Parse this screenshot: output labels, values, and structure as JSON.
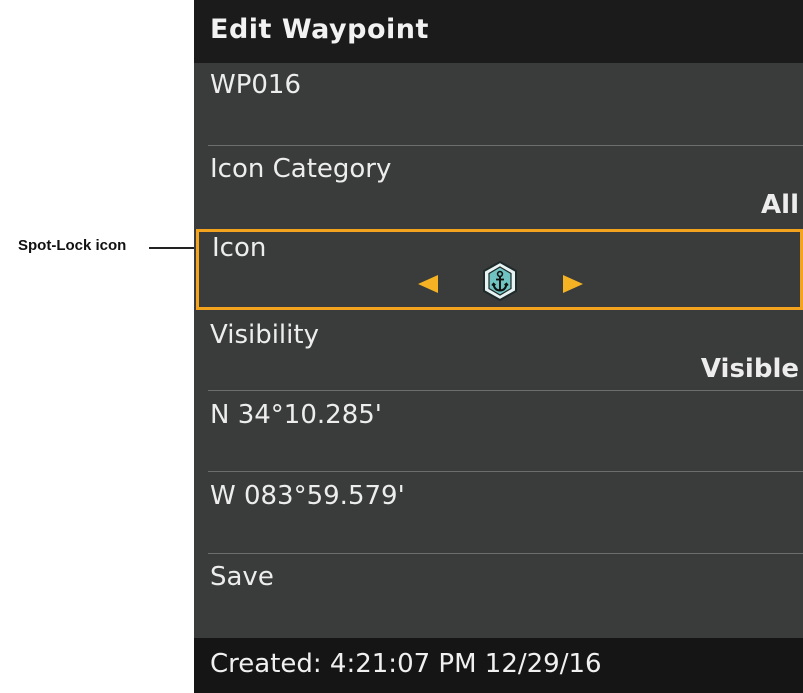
{
  "callout": {
    "label": "Spot-Lock icon"
  },
  "header": {
    "title": "Edit Waypoint"
  },
  "rows": {
    "name": {
      "label": "WP016"
    },
    "icon_category": {
      "label": "Icon Category",
      "value": "All"
    },
    "icon": {
      "label": "Icon",
      "current_icon": "anchor-spot-lock-icon",
      "prev": "arrow-left-icon",
      "next": "arrow-right-icon"
    },
    "visibility": {
      "label": "Visibility",
      "value": "Visible"
    },
    "latitude": {
      "label": "N 34°10.285'"
    },
    "longitude": {
      "label": "W 083°59.579'"
    },
    "save": {
      "label": "Save"
    }
  },
  "footer": {
    "text": "Created: 4:21:07 PM 12/29/16"
  },
  "colors": {
    "panel_bg": "#3a3c3c",
    "header_bg": "#1b1b1b",
    "selection_border": "#f3a31d",
    "arrow": "#f5b323",
    "icon_fill": "#6fc3c0"
  }
}
